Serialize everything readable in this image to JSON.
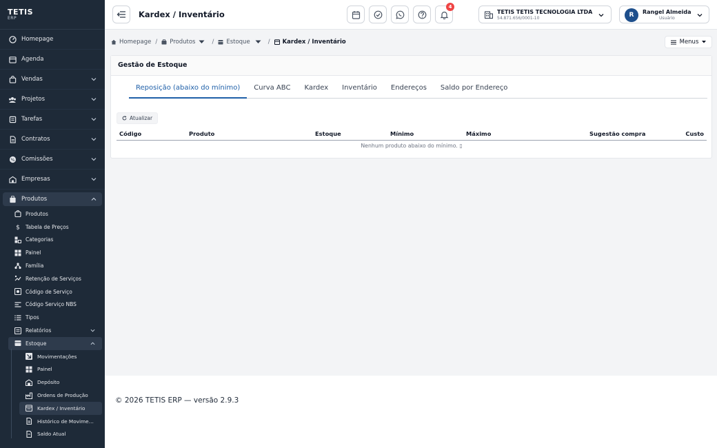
{
  "brand": {
    "logo": "TETIS",
    "sub": "ERP"
  },
  "sidebar": {
    "items": [
      {
        "label": "Homepage",
        "icon": "gauge-icon"
      },
      {
        "label": "Agenda",
        "icon": "calendar-icon"
      },
      {
        "label": "Vendas",
        "icon": "shopping-bag-icon"
      },
      {
        "label": "Projetos",
        "icon": "projects-icon"
      },
      {
        "label": "Tarefas",
        "icon": "tasks-icon"
      },
      {
        "label": "Contratos",
        "icon": "contract-icon"
      },
      {
        "label": "Comissões",
        "icon": "commission-icon"
      },
      {
        "label": "Empresas",
        "icon": "building-icon"
      },
      {
        "label": "Produtos",
        "icon": "box-icon"
      }
    ],
    "produtos_sub": [
      {
        "label": "Produtos",
        "icon": "package-icon"
      },
      {
        "label": "Tabela de Preços",
        "icon": "dollar-icon"
      },
      {
        "label": "Categorias",
        "icon": "categories-icon"
      },
      {
        "label": "Painel",
        "icon": "dashboard-icon"
      },
      {
        "label": "Família",
        "icon": "family-icon"
      },
      {
        "label": "Retenção de Serviços",
        "icon": "retention-icon"
      },
      {
        "label": "Código de Serviço",
        "icon": "service-code-icon"
      },
      {
        "label": "Código Serviço NBS",
        "icon": "nbs-icon"
      },
      {
        "label": "Tipos",
        "icon": "types-icon"
      },
      {
        "label": "Relatórios",
        "icon": "reports-icon"
      },
      {
        "label": "Estoque",
        "icon": "warehouse-icon"
      }
    ],
    "estoque_sub": [
      {
        "label": "Movimentações",
        "icon": "movements-icon"
      },
      {
        "label": "Painel",
        "icon": "dashboard-icon"
      },
      {
        "label": "Depósito",
        "icon": "depot-icon"
      },
      {
        "label": "Ordens de Produção",
        "icon": "factory-icon"
      },
      {
        "label": "Kardex / Inventário",
        "icon": "kardex-icon"
      },
      {
        "label": "Histórico de Movimentações",
        "icon": "history-icon"
      },
      {
        "label": "Saldo Atual",
        "icon": "balance-icon"
      }
    ]
  },
  "topbar": {
    "title": "Kardex / Inventário",
    "notifications_count": "4",
    "company_name": "TETIS TETIS TECNOLOGIA LTDA",
    "company_cnpj": "54.871.656/0001-10",
    "user_initial": "R",
    "user_name": "Rangel Almeida",
    "user_role": "Usuário"
  },
  "breadcrumb": {
    "home": "Homepage",
    "produtos": "Produtos",
    "estoque": "Estoque",
    "current": "Kardex / Inventário",
    "separator": "/"
  },
  "menus_label": "Menus",
  "card": {
    "title": "Gestão de Estoque",
    "tabs": [
      "Reposição (abaixo do mínimo)",
      "Curva ABC",
      "Kardex",
      "Inventário",
      "Endereços",
      "Saldo por Endereço"
    ],
    "refresh_label": "Atualizar",
    "columns": [
      "Código",
      "Produto",
      "Estoque",
      "Mínimo",
      "Máximo",
      "Sugestão compra",
      "Custo"
    ],
    "empty_message": "Nenhum produto abaixo do mínimo. ▯"
  },
  "footer": "© 2026 TETIS ERP — versão 2.9.3",
  "colors": {
    "sidebar": "#1e2a38",
    "accent": "#1e5fa8",
    "badge": "#ef4444"
  }
}
